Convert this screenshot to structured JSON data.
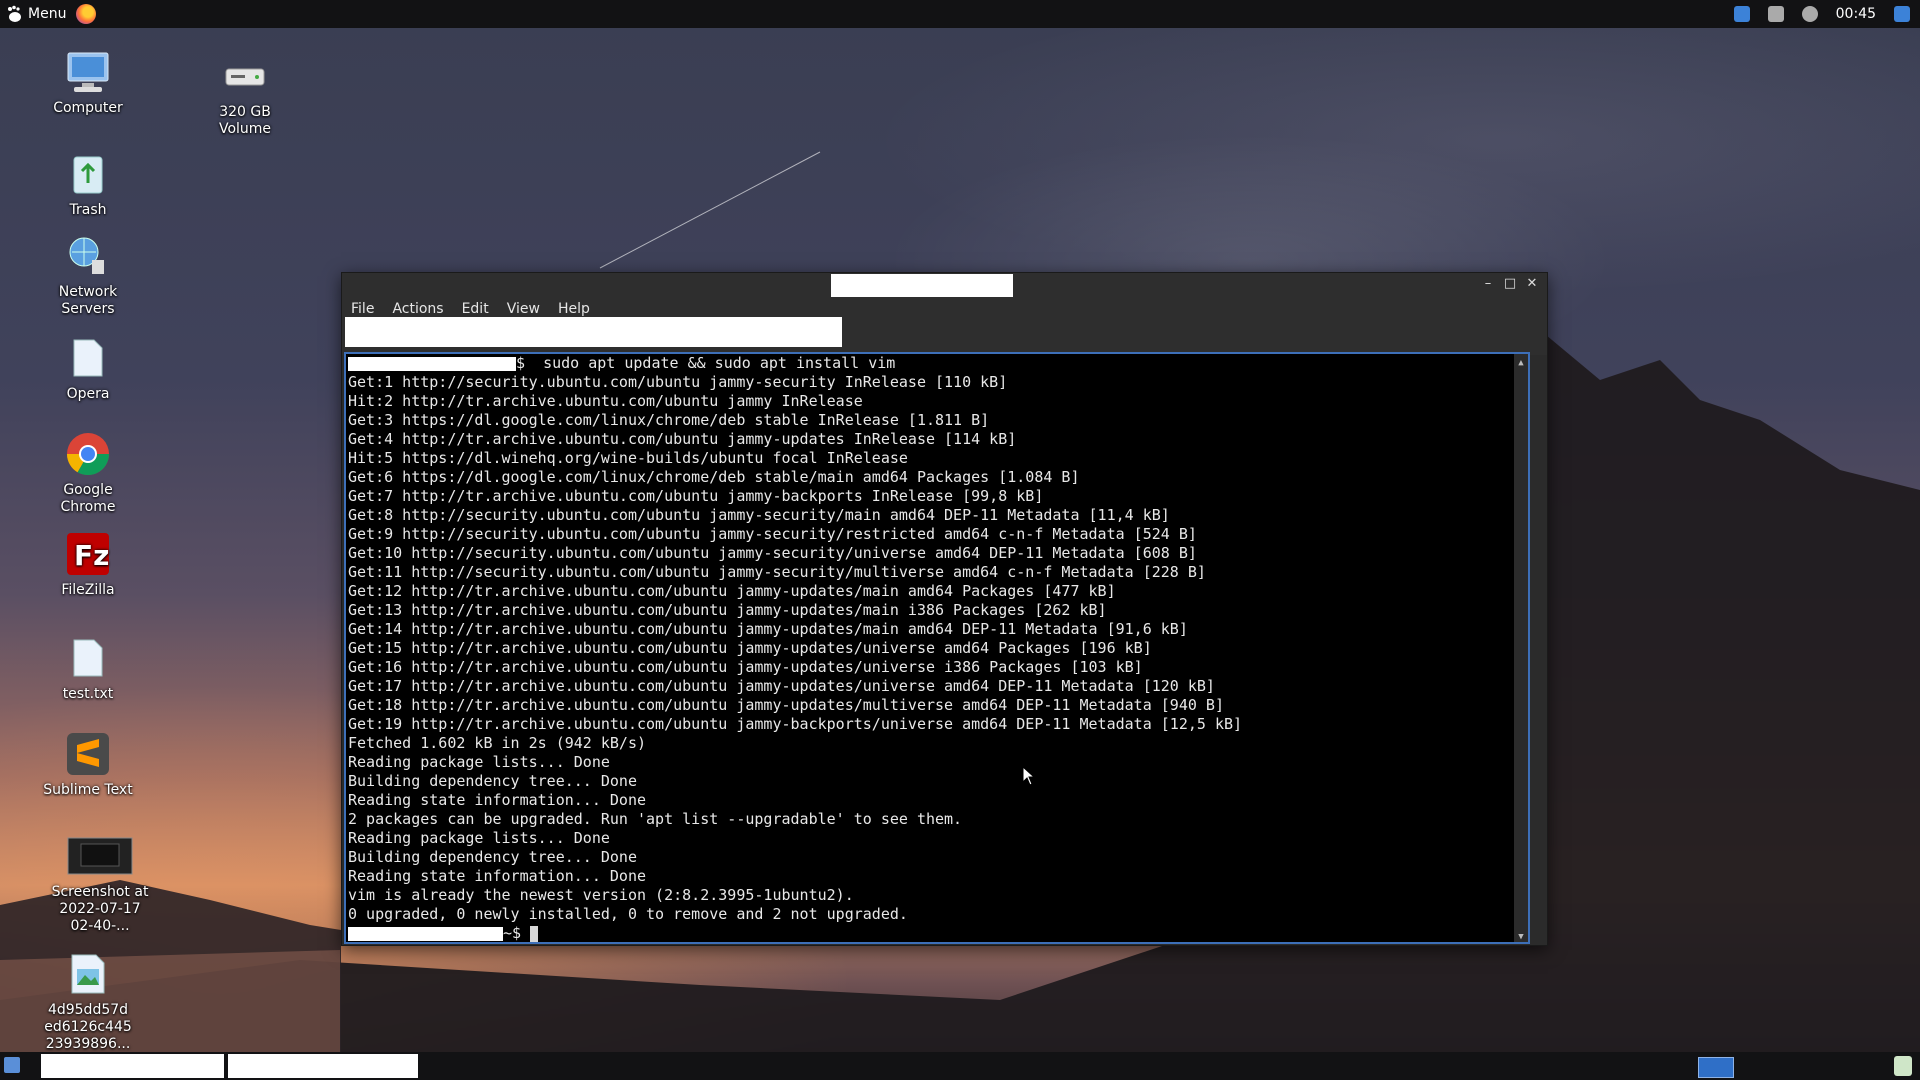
{
  "top_panel": {
    "menu_label": "Menu",
    "clock": "00:45"
  },
  "desktop_icons": [
    {
      "label": "Computer",
      "icon": "computer-icon"
    },
    {
      "label": "320 GB Volume",
      "icon": "drive-icon"
    },
    {
      "label": "Trash",
      "icon": "trash-icon"
    },
    {
      "label": "Network Servers",
      "icon": "network-icon"
    },
    {
      "label": "Opera",
      "icon": "file-icon"
    },
    {
      "label": "Google Chrome",
      "icon": "chrome-icon"
    },
    {
      "label": "FileZilla",
      "icon": "filezilla-icon"
    },
    {
      "label": "test.txt",
      "icon": "text-file-icon"
    },
    {
      "label": "Sublime Text",
      "icon": "sublime-icon"
    },
    {
      "label": "Screenshot at 2022-07-17 02-40-...",
      "icon": "screenshot-icon"
    },
    {
      "label": "4d95dd57d ed6126c445 23939896...",
      "icon": "image-file-icon"
    }
  ],
  "terminal": {
    "menu": [
      "File",
      "Actions",
      "Edit",
      "View",
      "Help"
    ],
    "command": "$  sudo apt update && sudo apt install vim",
    "output": [
      "Get:1 http://security.ubuntu.com/ubuntu jammy-security InRelease [110 kB]",
      "Hit:2 http://tr.archive.ubuntu.com/ubuntu jammy InRelease",
      "Get:3 https://dl.google.com/linux/chrome/deb stable InRelease [1.811 B]",
      "Get:4 http://tr.archive.ubuntu.com/ubuntu jammy-updates InRelease [114 kB]",
      "Hit:5 https://dl.winehq.org/wine-builds/ubuntu focal InRelease",
      "Get:6 https://dl.google.com/linux/chrome/deb stable/main amd64 Packages [1.084 B]",
      "Get:7 http://tr.archive.ubuntu.com/ubuntu jammy-backports InRelease [99,8 kB]",
      "Get:8 http://security.ubuntu.com/ubuntu jammy-security/main amd64 DEP-11 Metadata [11,4 kB]",
      "Get:9 http://security.ubuntu.com/ubuntu jammy-security/restricted amd64 c-n-f Metadata [524 B]",
      "Get:10 http://security.ubuntu.com/ubuntu jammy-security/universe amd64 DEP-11 Metadata [608 B]",
      "Get:11 http://security.ubuntu.com/ubuntu jammy-security/multiverse amd64 c-n-f Metadata [228 B]",
      "Get:12 http://tr.archive.ubuntu.com/ubuntu jammy-updates/main amd64 Packages [477 kB]",
      "Get:13 http://tr.archive.ubuntu.com/ubuntu jammy-updates/main i386 Packages [262 kB]",
      "Get:14 http://tr.archive.ubuntu.com/ubuntu jammy-updates/main amd64 DEP-11 Metadata [91,6 kB]",
      "Get:15 http://tr.archive.ubuntu.com/ubuntu jammy-updates/universe amd64 Packages [196 kB]",
      "Get:16 http://tr.archive.ubuntu.com/ubuntu jammy-updates/universe i386 Packages [103 kB]",
      "Get:17 http://tr.archive.ubuntu.com/ubuntu jammy-updates/universe amd64 DEP-11 Metadata [120 kB]",
      "Get:18 http://tr.archive.ubuntu.com/ubuntu jammy-updates/multiverse amd64 DEP-11 Metadata [940 B]",
      "Get:19 http://tr.archive.ubuntu.com/ubuntu jammy-backports/universe amd64 DEP-11 Metadata [12,5 kB]",
      "Fetched 1.602 kB in 2s (942 kB/s)",
      "Reading package lists... Done",
      "Building dependency tree... Done",
      "Reading state information... Done",
      "2 packages can be upgraded. Run 'apt list --upgradable' to see them.",
      "Reading package lists... Done",
      "Building dependency tree... Done",
      "Reading state information... Done",
      "vim is already the newest version (2:8.2.3995-1ubuntu2).",
      "0 upgraded, 0 newly installed, 0 to remove and 2 not upgraded."
    ],
    "prompt_suffix": "~$ "
  },
  "colors": {
    "terminal_bg": "#000000",
    "terminal_border": "#3d6fb8",
    "panel_bg": "#121214"
  }
}
